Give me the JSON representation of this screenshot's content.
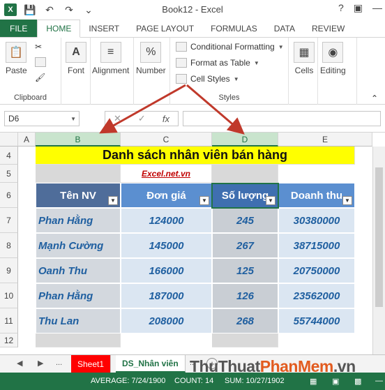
{
  "app": {
    "window_title": "Book12 - Excel",
    "icon_label": "X"
  },
  "tabs": [
    "FILE",
    "HOME",
    "INSERT",
    "PAGE LAYOUT",
    "FORMULAS",
    "DATA",
    "REVIEW"
  ],
  "active_tab": "HOME",
  "ribbon": {
    "clipboard": {
      "paste": "Paste",
      "label": "Clipboard"
    },
    "font": "Font",
    "alignment": "Alignment",
    "number": "Number",
    "number_symbol": "%",
    "styles": {
      "conditional": "Conditional Formatting",
      "format_table": "Format as Table",
      "cell_styles": "Cell Styles",
      "label": "Styles"
    },
    "cells": "Cells",
    "editing": "Editing"
  },
  "formula_bar": {
    "name_box": "D6",
    "fx": "fx",
    "value": ""
  },
  "grid": {
    "columns": [
      "A",
      "B",
      "C",
      "D",
      "E"
    ],
    "rows": [
      "4",
      "5",
      "6",
      "7",
      "8",
      "9",
      "10",
      "11",
      "12"
    ],
    "title": "Danh sách nhân viên bán hàng",
    "subtitle": "Excel.net.vn",
    "headers": [
      "Tên NV",
      "Đơn giá",
      "Số lượng",
      "Doanh thu"
    ],
    "records": [
      {
        "name": "Phan Hằng",
        "price": "124000",
        "qty": "245",
        "revenue": "30380000"
      },
      {
        "name": "Mạnh Cường",
        "price": "145000",
        "qty": "267",
        "revenue": "38715000"
      },
      {
        "name": "Oanh Thu",
        "price": "166000",
        "qty": "125",
        "revenue": "20750000"
      },
      {
        "name": "Phan Hằng",
        "price": "187000",
        "qty": "126",
        "revenue": "23562000"
      },
      {
        "name": "Thu Lan",
        "price": "208000",
        "qty": "268",
        "revenue": "55744000"
      }
    ]
  },
  "sheets": {
    "nav_prev": "...",
    "sheet1": "Sheet1",
    "active": "DS_Nhân viên",
    "nav_next": "..."
  },
  "status": {
    "average": "AVERAGE: 7/24/1900",
    "count": "COUNT: 14",
    "sum": "SUM: 10/27/1902"
  },
  "watermark": {
    "part1": "ThuThuat",
    "part2": "PhanMem",
    "part3": ".vn"
  },
  "colors": {
    "excel_green": "#217346",
    "title_fill": "#ffff00",
    "arrow_red": "#c0392b"
  }
}
